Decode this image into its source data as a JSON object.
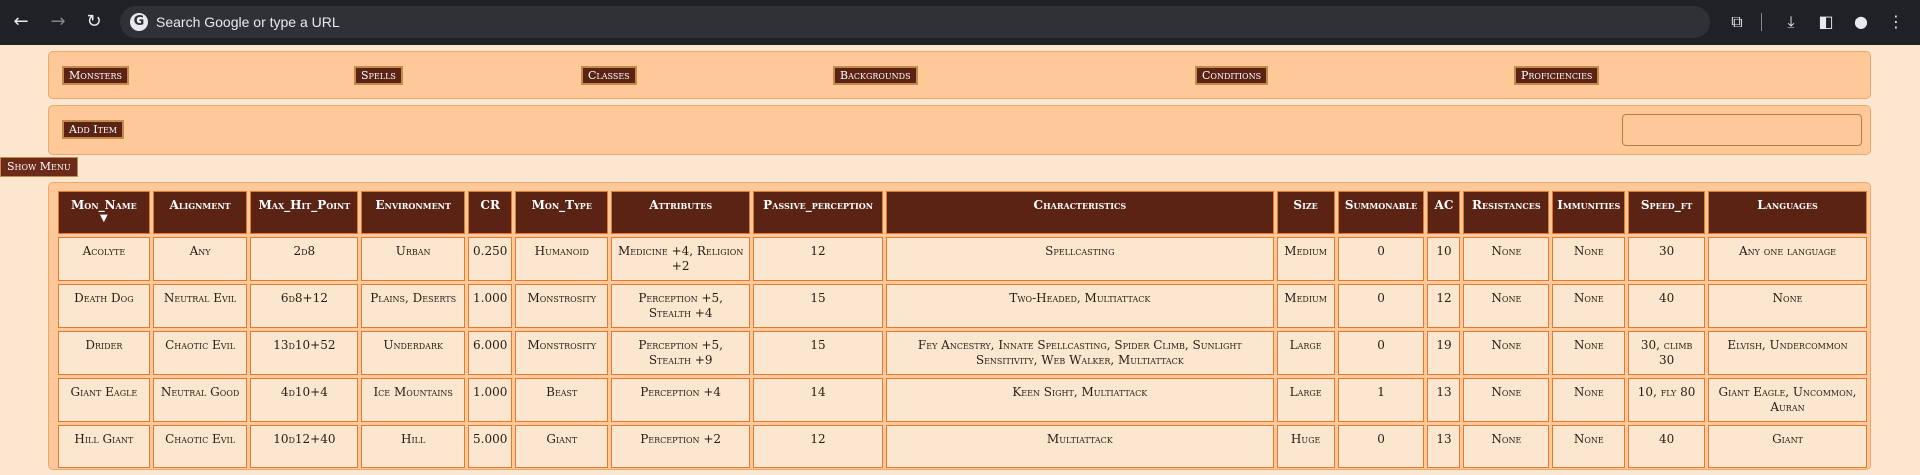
{
  "browser": {
    "omnibox_placeholder": "Search Google or type a URL",
    "google_letter": "G"
  },
  "nav": {
    "items": [
      "Monsters",
      "Spells",
      "Classes",
      "Backgrounds",
      "Conditions",
      "Proficiencies"
    ]
  },
  "toolbar": {
    "add_item_label": "Add Item",
    "search_value": ""
  },
  "show_menu_label": "Show Menu",
  "table": {
    "sort_indicator": "▼",
    "headers": [
      "Mon_Name",
      "Alignment",
      "Max_Hit_Point",
      "Environment",
      "CR",
      "Mon_Type",
      "Attributes",
      "Passive_perception",
      "Characteristics",
      "Size",
      "Summonable",
      "AC",
      "Resistances",
      "Immunities",
      "Speed_ft",
      "Languages"
    ],
    "rows": [
      [
        "Acolyte",
        "Any",
        "2d8",
        "Urban",
        "0.250",
        "Humanoid",
        "Medicine +4, Religion +2",
        "12",
        "Spellcasting",
        "Medium",
        "0",
        "10",
        "None",
        "None",
        "30",
        "Any one language"
      ],
      [
        "Death Dog",
        "Neutral Evil",
        "6d8+12",
        "Plains, Deserts",
        "1.000",
        "Monstrosity",
        "Perception +5, Stealth +4",
        "15",
        "Two-Headed, Multiattack",
        "Medium",
        "0",
        "12",
        "None",
        "None",
        "40",
        "None"
      ],
      [
        "Drider",
        "Chaotic Evil",
        "13d10+52",
        "Underdark",
        "6.000",
        "Monstrosity",
        "Perception +5, Stealth +9",
        "15",
        "Fey Ancestry, Innate Spellcasting, Spider Climb, Sunlight Sensitivity, Web Walker, Multiattack",
        "Large",
        "0",
        "19",
        "None",
        "None",
        "30, climb 30",
        "Elvish, Undercommon"
      ],
      [
        "Giant Eagle",
        "Neutral Good",
        "4d10+4",
        "Ice Mountains",
        "1.000",
        "Beast",
        "Perception +4",
        "14",
        "Keen Sight, Multiattack",
        "Large",
        "1",
        "13",
        "None",
        "None",
        "10, fly 80",
        "Giant Eagle, Uncommon, Auran"
      ],
      [
        "Hill Giant",
        "Chaotic Evil",
        "10d12+40",
        "Hill",
        "5.000",
        "Giant",
        "Perception +2",
        "12",
        "Multiattack",
        "Huge",
        "0",
        "13",
        "None",
        "None",
        "40",
        "Giant"
      ]
    ]
  },
  "colors": {
    "page_bg": "#fbe6cf",
    "panel_bg": "#ffc899",
    "header_bg": "#5a2314",
    "cell_border": "#e07a33"
  }
}
